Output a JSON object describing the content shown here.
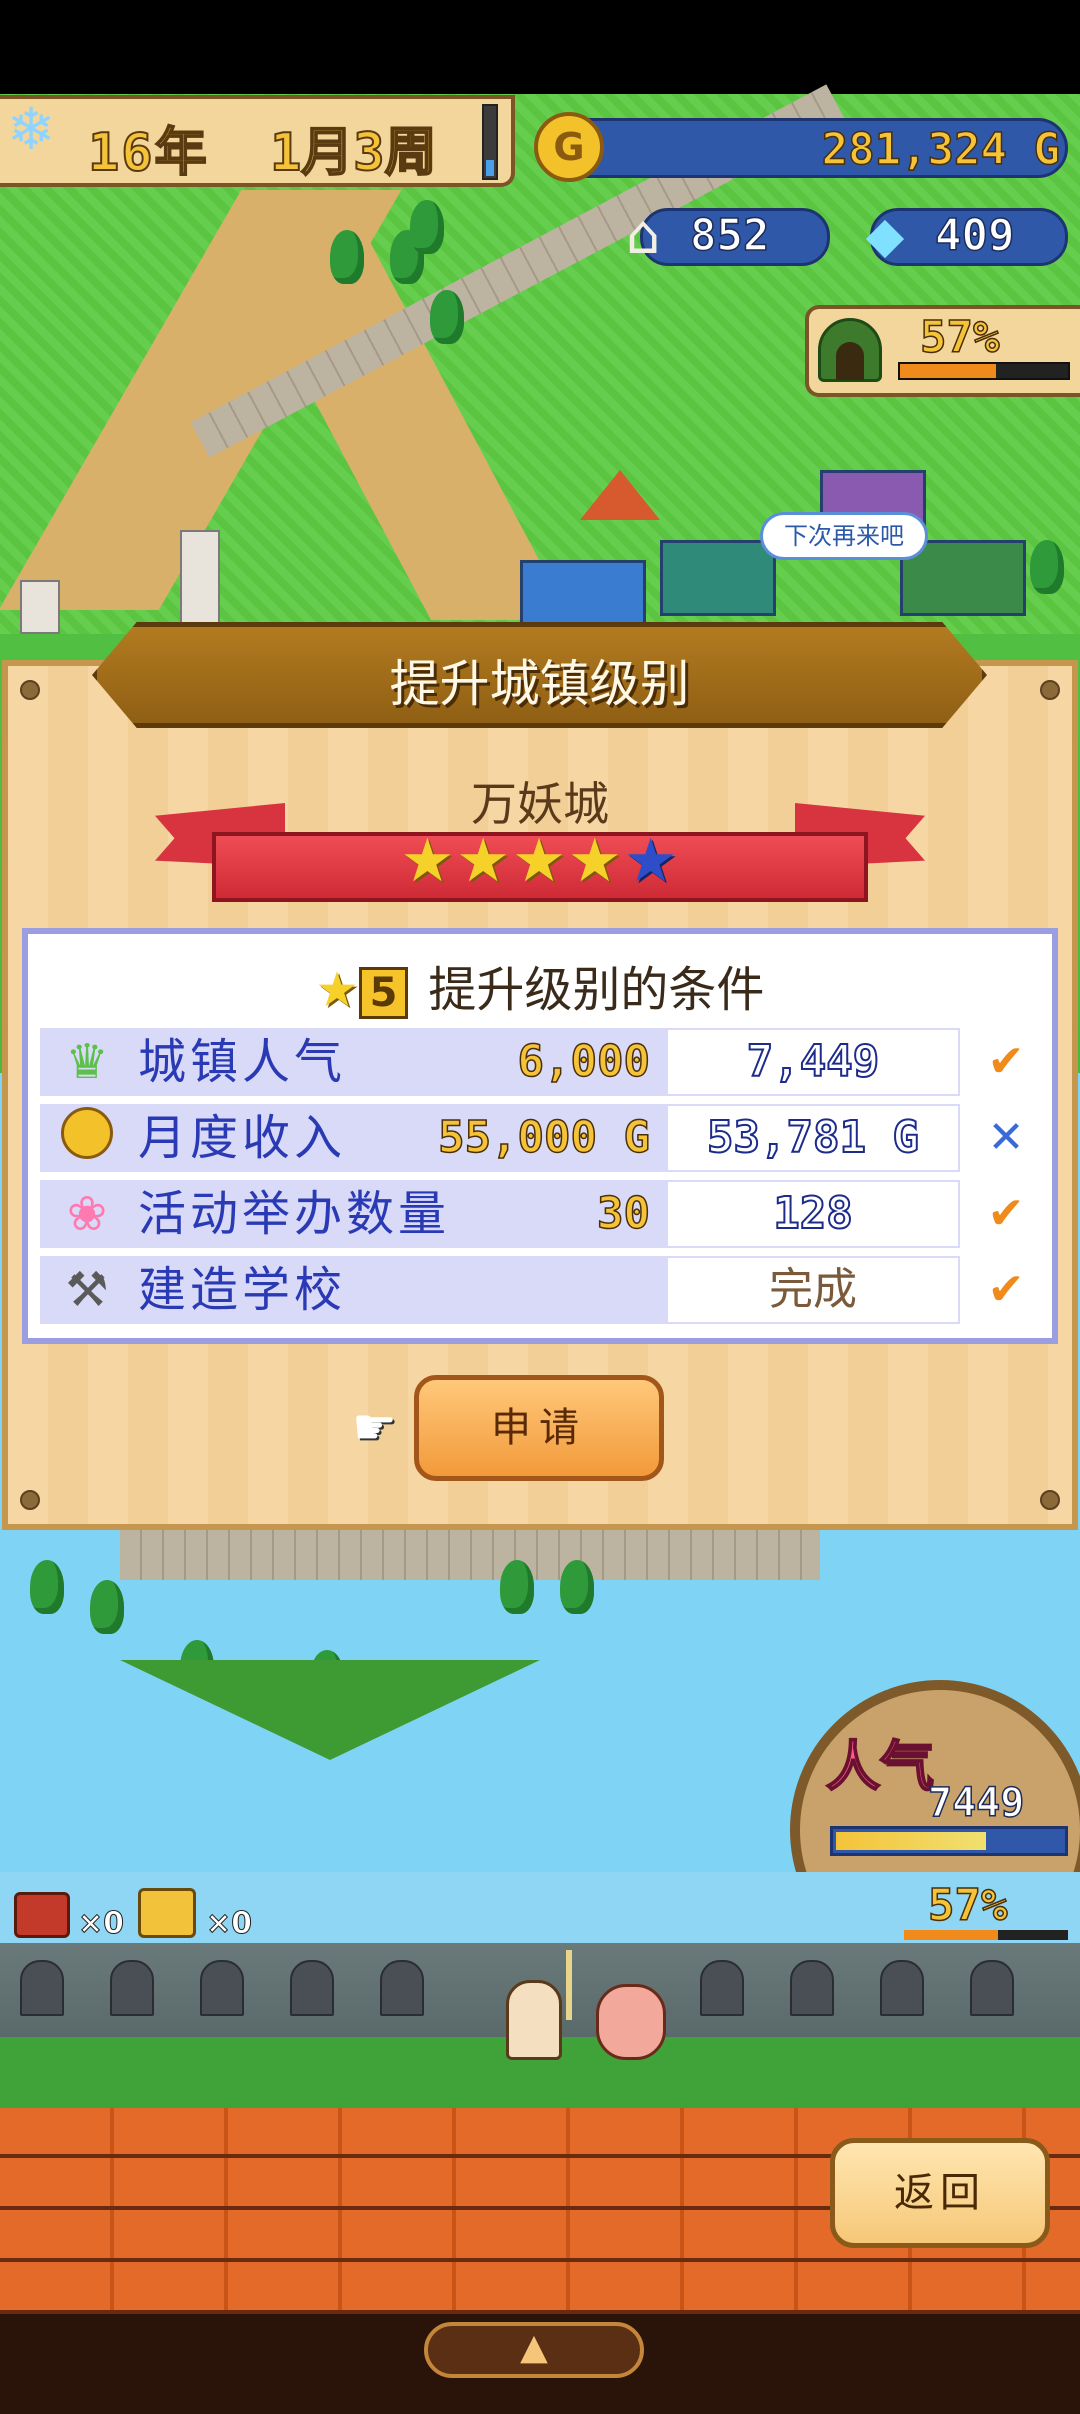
{
  "hud": {
    "year": "16年",
    "week": "1月3周",
    "gold": "281,324 G",
    "population": "852",
    "crystals": "409",
    "dungeon_progress": "57%"
  },
  "speech_bubble": "下次再来吧",
  "modal": {
    "title": "提升城镇级别",
    "town_name": "万妖城",
    "stars_filled": 4,
    "stars_total": 5,
    "condition_level": "5",
    "condition_title": "提升级别的条件",
    "rows": [
      {
        "icon": "trophy-icon",
        "label": "城镇人气",
        "required": "6,000",
        "current": "7,449",
        "status": "✔",
        "met": true
      },
      {
        "icon": "gold-coin-icon",
        "label": "月度收入",
        "required": "55,000 G",
        "current": "53,781 G",
        "status": "✕",
        "met": false
      },
      {
        "icon": "balloons-icon",
        "label": "活动举办数量",
        "required": "30",
        "current": "128",
        "status": "✔",
        "met": true
      },
      {
        "icon": "hammer-icon",
        "label": "建造学校",
        "required": "",
        "current": "完成",
        "status": "✔",
        "met": true
      }
    ],
    "apply_label": "申请"
  },
  "popularity": {
    "label": "人气",
    "value": "7449"
  },
  "battle": {
    "chest_red_count": "×0",
    "chest_gold_count": "×0",
    "progress": "57%"
  },
  "back_label": "返回",
  "colors": {
    "accent_gold": "#f4c33a",
    "panel_border": "#9b9ee0",
    "ribbon_red": "#d7343f",
    "check_orange": "#f08a1a",
    "cross_blue": "#3a6ad8"
  }
}
